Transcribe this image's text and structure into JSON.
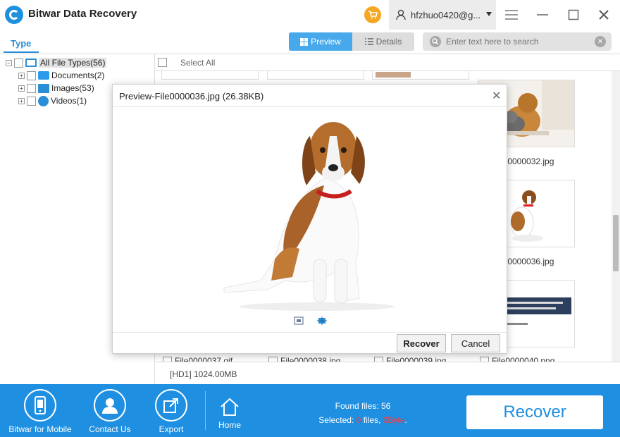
{
  "app": {
    "title": "Bitwar Data Recovery"
  },
  "user": {
    "name": "hfzhuo0420@g..."
  },
  "tabs": {
    "type": "Type"
  },
  "view": {
    "preview": "Preview",
    "details": "Details"
  },
  "search": {
    "placeholder": "Enter text here to search"
  },
  "tree": {
    "root": "All File Types(56)",
    "items": [
      {
        "label": "Documents(2)",
        "icon": "folder-icon"
      },
      {
        "label": "Images(53)",
        "icon": "image-icon"
      },
      {
        "label": "Videos(1)",
        "icon": "video-icon"
      }
    ]
  },
  "main": {
    "select_all": "Select All",
    "thumbs": [
      {
        "name": "File0000032.jpg"
      },
      {
        "name": "File0000036.jpg"
      }
    ],
    "bottom_files": [
      "File0000037.gif",
      "File0000038.jpg",
      "File0000039.jpg",
      "File0000040.png"
    ]
  },
  "status": {
    "drive": "[HD1] 1024.00MB"
  },
  "bottom": {
    "mobile": "Bitwar for Mobile",
    "contact": "Contact Us",
    "export": "Export",
    "home": "Home",
    "found": "Found files: 56",
    "selected_prefix": "Selected: ",
    "selected_count": "0",
    "selected_mid": " files, ",
    "selected_size": "0Byte",
    "selected_suffix": ".",
    "recover": "Recover"
  },
  "modal": {
    "title": "Preview-File0000036.jpg (26.38KB)",
    "recover": "Recover",
    "cancel": "Cancel"
  },
  "colors": {
    "accent": "#1e8fe1",
    "cart": "#f5a623",
    "highlight_red": "#ff3b3b"
  }
}
